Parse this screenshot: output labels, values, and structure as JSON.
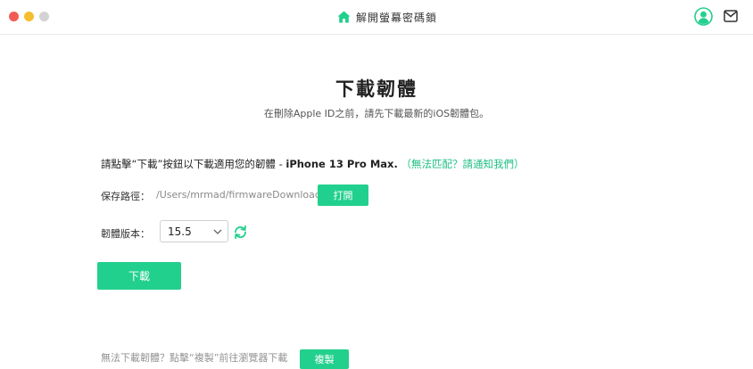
{
  "window": {
    "title": "解開螢幕密碼鎖"
  },
  "main": {
    "title": "下載韌體",
    "subtitle": "在刪除Apple ID之前，請先下載最新的iOS韌體包。",
    "instruction_prefix": "請點擊“下載”按鈕以下載適用您的韌體 - ",
    "instruction_model": "iPhone 13 Pro Max.",
    "instruction_link": "（無法匹配？請通知我們）",
    "path_label": "保存路徑：",
    "path_value": "/Users/mrmad/firmwareDownload",
    "open_button": "打開",
    "version_label": "韌體版本：",
    "version_value": "15.5",
    "download_button": "下載",
    "bottom_text": "無法下載韌體？點擊“複製”前往瀏覽器下載",
    "copy_button": "複製"
  },
  "colors": {
    "accent": "#22d08d",
    "link": "#1fbf83"
  },
  "icons": {
    "title_icon": "home-icon",
    "user": "user-icon",
    "mail": "mail-icon",
    "refresh": "refresh-icon",
    "dropdown": "chevron-down-icon"
  }
}
